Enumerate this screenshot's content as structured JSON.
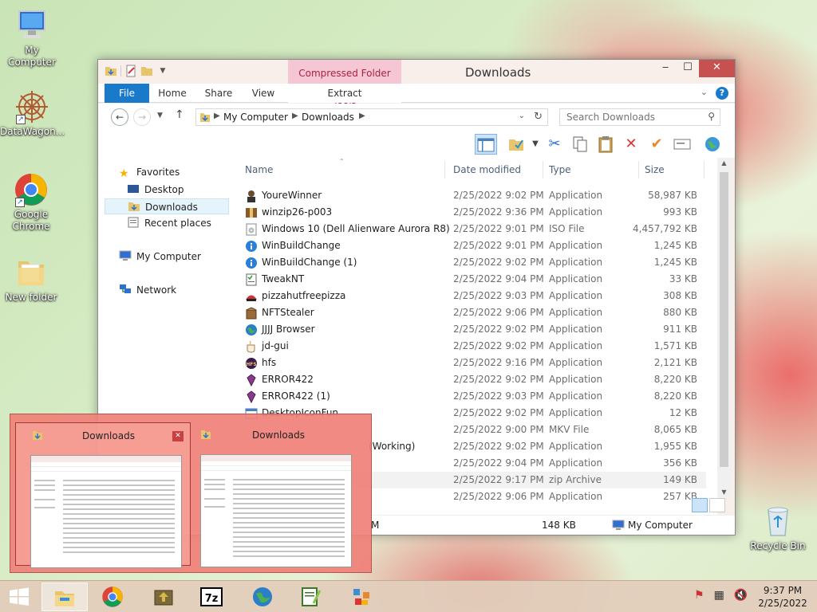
{
  "desktop": {
    "icons": [
      {
        "label": "My Computer",
        "icon": "computer-icon"
      },
      {
        "label": "DataWagon...",
        "icon": "datawagon-icon"
      },
      {
        "label": "Google Chrome",
        "icon": "chrome-icon"
      },
      {
        "label": "New folder",
        "icon": "folder-icon"
      },
      {
        "label": "Recycle Bin",
        "icon": "recycle-bin-icon"
      }
    ]
  },
  "window": {
    "title": "Downloads",
    "contextual_tab": "Compressed Folder Tools",
    "ribbon_tabs": [
      "File",
      "Home",
      "Share",
      "View",
      "Extract"
    ],
    "address": {
      "crumbs": [
        "My Computer",
        "Downloads"
      ]
    },
    "search_placeholder": "Search Downloads",
    "nav": {
      "favorites": "Favorites",
      "items": [
        "Desktop",
        "Downloads",
        "Recent places"
      ],
      "computer": "My Computer",
      "network": "Network"
    },
    "columns": [
      "Name",
      "Date modified",
      "Type",
      "Size"
    ],
    "files": [
      {
        "name": "YoureWinner",
        "date": "2/25/2022 9:02 PM",
        "type": "Application",
        "size": "58,987 KB",
        "icon": "person-icon"
      },
      {
        "name": "winzip26-p003",
        "date": "2/25/2022 9:36 PM",
        "type": "Application",
        "size": "993 KB",
        "icon": "winzip-icon"
      },
      {
        "name": "Windows 10 (Dell Alienware Aurora R8)",
        "date": "2/25/2022 9:01 PM",
        "type": "ISO File",
        "size": "4,457,792 KB",
        "icon": "disc-image-icon"
      },
      {
        "name": "WinBuildChange",
        "date": "2/25/2022 9:01 PM",
        "type": "Application",
        "size": "1,245 KB",
        "icon": "info-icon"
      },
      {
        "name": "WinBuildChange (1)",
        "date": "2/25/2022 9:02 PM",
        "type": "Application",
        "size": "1,245 KB",
        "icon": "info-icon"
      },
      {
        "name": "TweakNT",
        "date": "2/25/2022 9:04 PM",
        "type": "Application",
        "size": "33 KB",
        "icon": "checklist-icon"
      },
      {
        "name": "pizzahutfreepizza",
        "date": "2/25/2022 9:03 PM",
        "type": "Application",
        "size": "308 KB",
        "icon": "pizza-icon"
      },
      {
        "name": "NFTStealer",
        "date": "2/25/2022 9:06 PM",
        "type": "Application",
        "size": "880 KB",
        "icon": "box-icon"
      },
      {
        "name": "JJJJ Browser",
        "date": "2/25/2022 9:02 PM",
        "type": "Application",
        "size": "911 KB",
        "icon": "globe-icon"
      },
      {
        "name": "jd-gui",
        "date": "2/25/2022 9:02 PM",
        "type": "Application",
        "size": "1,571 KB",
        "icon": "coffee-icon"
      },
      {
        "name": "hfs",
        "date": "2/25/2022 9:16 PM",
        "type": "Application",
        "size": "2,121 KB",
        "icon": "hfs-icon"
      },
      {
        "name": "ERROR422",
        "date": "2/25/2022 9:02 PM",
        "type": "Application",
        "size": "8,220 KB",
        "icon": "gem-icon"
      },
      {
        "name": "ERROR422 (1)",
        "date": "2/25/2022 9:03 PM",
        "type": "Application",
        "size": "8,220 KB",
        "icon": "gem-icon"
      },
      {
        "name": "DesktopIconFun",
        "date": "2/25/2022 9:02 PM",
        "type": "Application",
        "size": "12 KB",
        "icon": "window-icon"
      },
      {
        "name": "",
        "date": "2/25/2022 9:00 PM",
        "type": "MKV File",
        "size": "8,065 KB",
        "icon": ""
      },
      {
        "name": "(Working)",
        "date": "2/25/2022 9:02 PM",
        "type": "Application",
        "size": "1,955 KB",
        "icon": ""
      },
      {
        "name": "",
        "date": "2/25/2022 9:04 PM",
        "type": "Application",
        "size": "356 KB",
        "icon": ""
      },
      {
        "name": "",
        "date": "2/25/2022 9:17 PM",
        "type": "zip Archive",
        "size": "149 KB",
        "icon": ""
      },
      {
        "name": "",
        "date": "2/25/2022 9:06 PM",
        "type": "Application",
        "size": "257 KB",
        "icon": ""
      }
    ],
    "status": {
      "left": "M",
      "size": "148 KB",
      "location": "My Computer"
    }
  },
  "preview": {
    "items": [
      {
        "title": "Downloads"
      },
      {
        "title": "Downloads"
      }
    ]
  },
  "taskbar": {
    "apps": [
      "file-explorer-icon",
      "chrome-icon",
      "installer-icon",
      "7zip-icon",
      "globe-icon",
      "notepad-plus-icon",
      "registry-icon"
    ],
    "time": "9:37 PM",
    "date": "2/25/2022"
  },
  "colors": {
    "accent": "#1979ca",
    "preview_bg": "#f08078",
    "close_red": "#c75050"
  }
}
